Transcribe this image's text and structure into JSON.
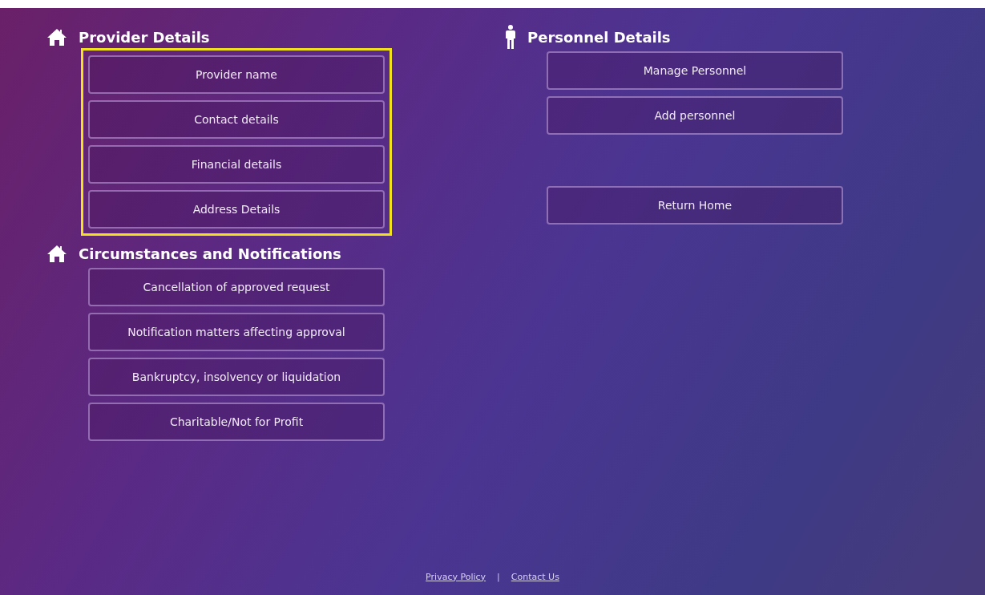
{
  "sections": [
    {
      "title": "Provider Details",
      "kind": "organisation",
      "highlighted": true,
      "buttons": [
        "Provider name",
        "Contact details",
        "Financial details",
        "Address Details"
      ]
    },
    {
      "title": "Circumstances and Notifications",
      "kind": "organisation",
      "highlighted": false,
      "buttons": [
        "Cancellation of approved request",
        "Notification matters affecting approval",
        "Bankruptcy, insolvency or liquidation",
        "Charitable/Not for Profit"
      ]
    },
    {
      "title": "Personnel Details",
      "kind": "personnel",
      "highlighted": false,
      "buttons": [
        "Manage Personnel",
        "Add personnel"
      ]
    }
  ],
  "return_button": "Return Home",
  "footer": {
    "links": [
      "Privacy Policy",
      "Contact Us"
    ],
    "separator": "|"
  }
}
